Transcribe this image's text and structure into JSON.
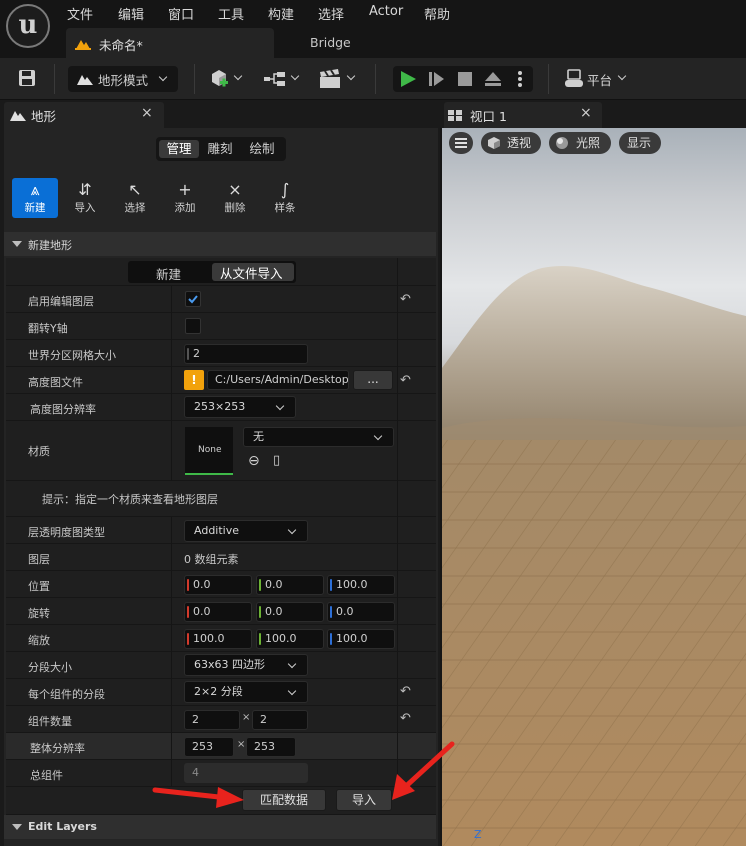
{
  "menu": {
    "logo": "u",
    "items": [
      "文件",
      "编辑",
      "窗口",
      "工具",
      "构建",
      "选择",
      "Actor",
      "帮助"
    ]
  },
  "tabs": {
    "document": "未命名*",
    "bridge": "Bridge"
  },
  "toolbar": {
    "mode_label": "地形模式",
    "platform_label": "平台"
  },
  "panel": {
    "title": "地形",
    "close": "×",
    "segments": [
      "管理",
      "雕刻",
      "绘制"
    ],
    "active_segment": "管理",
    "tools": [
      "新建",
      "导入",
      "选择",
      "添加",
      "删除",
      "样条"
    ],
    "section_new": "新建地形",
    "sub_tabs": [
      "新建",
      "从文件导入"
    ],
    "rows": {
      "enable_edit_layers": "启用编辑图层",
      "flip_y": "翻转Y轴",
      "world_partition_grid": "世界分区网格大小",
      "world_partition_value": "2",
      "heightmap_file": "高度图文件",
      "heightmap_path": "C:/Users/Admin/Desktop/.",
      "browse": "...",
      "warning": "!",
      "heightmap_resolution": "高度图分辨率",
      "heightmap_resolution_value": "253×253",
      "material": "材质",
      "material_thumb": "None",
      "material_value": "无",
      "hint": "提示：指定一个材质来查看地形图层",
      "layer_alpha_type": "层透明度图类型",
      "layer_alpha_value": "Additive",
      "layers": "图层",
      "layers_value": "0 数组元素",
      "location": "位置",
      "location_values": [
        "0.0",
        "0.0",
        "100.0"
      ],
      "rotation": "旋转",
      "rotation_values": [
        "0.0",
        "0.0",
        "0.0"
      ],
      "scale": "缩放",
      "scale_values": [
        "100.0",
        "100.0",
        "100.0"
      ],
      "section_size": "分段大小",
      "section_size_value": "63x63 四边形",
      "sections_per_component": "每个组件的分段",
      "sections_per_component_value": "2×2 分段",
      "component_count": "组件数量",
      "component_count_values": [
        "2",
        "2"
      ],
      "overall_resolution": "整体分辨率",
      "overall_resolution_values": [
        "253",
        "253"
      ],
      "total_components": "总组件",
      "total_components_value": "4",
      "times": "×"
    },
    "buttons": {
      "fit_data": "匹配数据",
      "import": "导入"
    },
    "section_edit_layers": "Edit Layers"
  },
  "viewport": {
    "title": "视口 1",
    "close": "×",
    "perspective": "透视",
    "lighting": "光照",
    "show": "显示",
    "axis_label": "Z"
  },
  "colors": {
    "accent_blue": "#0a6fd6",
    "play_green": "#3fb948",
    "warning_orange": "#f2a20c",
    "axis_x": "#d33a2c",
    "axis_y": "#6cb334",
    "axis_z": "#2d6fd6",
    "arrow_red": "#e8231d"
  }
}
